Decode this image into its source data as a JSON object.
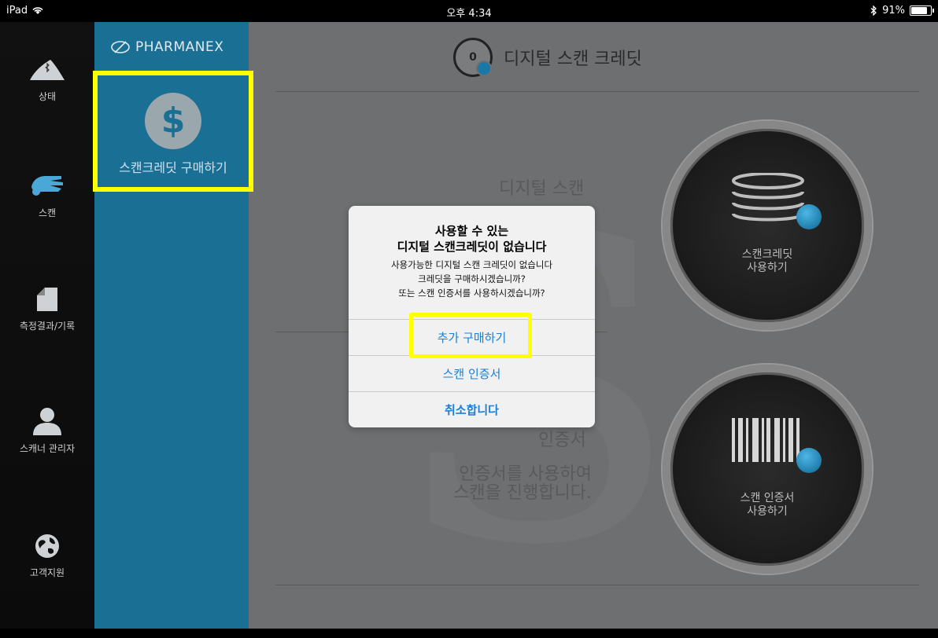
{
  "statusbar": {
    "device": "iPad",
    "time": "오후 4:34",
    "battery": "91%",
    "battery_level": 0.91
  },
  "leftnav": {
    "items": [
      {
        "label": "상태",
        "icon": "shoe-bluetooth-icon"
      },
      {
        "label": "스캔",
        "icon": "hand-scan-icon"
      },
      {
        "label": "측정결과/기록",
        "icon": "document-icon"
      },
      {
        "label": "스캐너 관리자",
        "icon": "person-icon"
      },
      {
        "label": "고객지원",
        "icon": "globe-icon"
      }
    ]
  },
  "panel": {
    "brand": "PHARMANEX",
    "buy_credit_label": "스캔크레딧 구매하기",
    "dollar_symbol": "$"
  },
  "main": {
    "counter": "0",
    "title": "디지털 스캔 크레딧",
    "section1_heading": "디지털 스캔",
    "section2_heading": "인증서",
    "section2_desc_line1": "인증서를 사용하여",
    "section2_desc_line2": "스캔을 진행합니다.",
    "button_credit_line1": "스캔크레딧",
    "button_credit_line2": "사용하기",
    "button_cert_line1": "스캔 인증서",
    "button_cert_line2": "사용하기"
  },
  "alert": {
    "title_line1": "사용할 수 있는",
    "title_line2": "디지털 스캔크레딧이 없습니다",
    "msg_line1": "사용가능한 디지털 스캔 크레딧이 없습니다",
    "msg_line2": "크레딧을 구매하시겠습니까?",
    "msg_line3": "또는 스캔 인증서를 사용하시겠습니까?",
    "btn_buy": "추가 구매하기",
    "btn_cert": "스캔 인증서",
    "btn_cancel": "취소합니다"
  },
  "colors": {
    "panel": "#1a6f95",
    "highlight": "#ffff00",
    "link": "#1a7fd6"
  }
}
